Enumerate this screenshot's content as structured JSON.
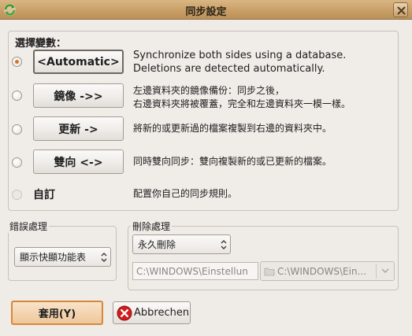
{
  "window": {
    "title": "同步設定",
    "app_icon": "sync-arrows-icon",
    "close_icon": "close-icon"
  },
  "variant_group": {
    "title": "選擇變數："
  },
  "modes": [
    {
      "button_label": "<Automatic>",
      "selected": true,
      "description_line1": "Synchronize both sides using a database.",
      "description_line2": "Deletions are detected automatically."
    },
    {
      "button_label": "鏡像  ->>",
      "selected": false,
      "description_line1": "左邊資料夾的鏡像備份：同步之後，",
      "description_line2": "右邊資料夾將被覆蓋，完全和左邊資料夾一模一樣。"
    },
    {
      "button_label": "更新  ->",
      "selected": false,
      "description_line1": "將新的或更新過的檔案複製到右邊的資料夾中。"
    },
    {
      "button_label": "雙向  <->",
      "selected": false,
      "description_line1": "同時雙向同步：雙向複製新的或已更新的檔案。"
    },
    {
      "button_label": "自訂",
      "selected": false,
      "disabled": true,
      "description_line1": "配置你自己的同步規則。"
    }
  ],
  "error_handling": {
    "title": "錯誤處理",
    "selected": "顯示快顯功能表"
  },
  "deletion_handling": {
    "title": "刪除處理",
    "selected": "永久刪除",
    "path_entry_value": "C:\\WINDOWS\\Einstellun",
    "path_combo_value": "C:\\WINDOWS\\Ein..."
  },
  "buttons": {
    "apply_label": "套用(Y)",
    "cancel_label": "Abbrechen"
  },
  "colors": {
    "titlebar": "#c99f67",
    "radio_selected": "#d4742c",
    "apply_border": "#d6883a",
    "cancel_icon_red": "#d21c1c"
  }
}
